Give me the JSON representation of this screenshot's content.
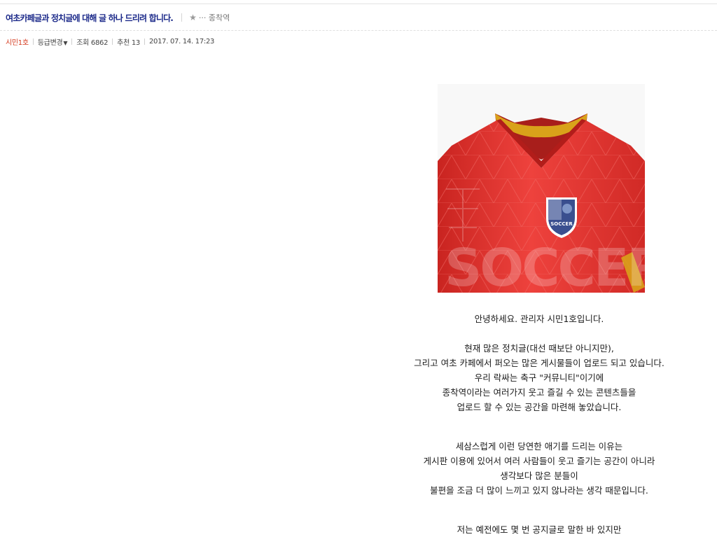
{
  "post": {
    "title": "여초카페글과 정치글에 대해 글 하나 드리려 합니다.",
    "category_icon": "star-icon",
    "category": "종착역"
  },
  "meta": {
    "author": "시민1호",
    "grade_change": "등급변경",
    "views": "조회 6862",
    "recommends": "추천 13",
    "date": "2017. 07. 14.  17:23"
  },
  "image": {
    "watermark": "SOCCER",
    "badge_text": "SOCCER",
    "colors": {
      "shirt": "#e53a35",
      "collar_accent": "#d9a21a",
      "badge": "#3a4f8f"
    }
  },
  "body_lines": [
    "안녕하세요. 관리자 시민1호입니다.",
    "",
    "현재 많은 정치글(대선 때보단 아니지만),",
    "그리고 여초 카페에서 퍼오는 많은 게시물들이 업로드 되고 있습니다.",
    "우리 락싸는 축구 \"커뮤니티\"이기에",
    "종착역이라는 여러가지 웃고 즐길 수 있는 콘텐츠들을",
    "업로드 할 수 있는 공간을 마련해 놓았습니다.",
    "",
    "세삼스럽게 이런 당연한 애기를 드리는 이유는",
    "게시판 이용에 있어서 여러 사람들이 웃고 즐기는 공간이 아니라",
    "생각보다 많은 분들이",
    "불편을 조금 더 많이 느끼고 있지 않나라는 생각 때문입니다.",
    "",
    "저는 예전에도 몇 번 공지글로 말한 바 있지만"
  ]
}
